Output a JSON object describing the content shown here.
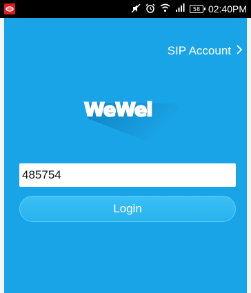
{
  "status_bar": {
    "app_icon": "red-lips-notification-icon",
    "icons": [
      "mute-icon",
      "alarm-icon",
      "wifi-icon",
      "signal-icon"
    ],
    "battery_level": "58",
    "time": "02:40PM"
  },
  "header": {
    "sip_account_label": "SIP Account",
    "chevron": "chevron-right-icon"
  },
  "logo": {
    "text": "WeWei"
  },
  "login_form": {
    "account_value": "485754",
    "login_label": "Login"
  },
  "colors": {
    "background": "#1aa4e8",
    "button": "#2fb7f0",
    "status_bar": "#000000"
  }
}
